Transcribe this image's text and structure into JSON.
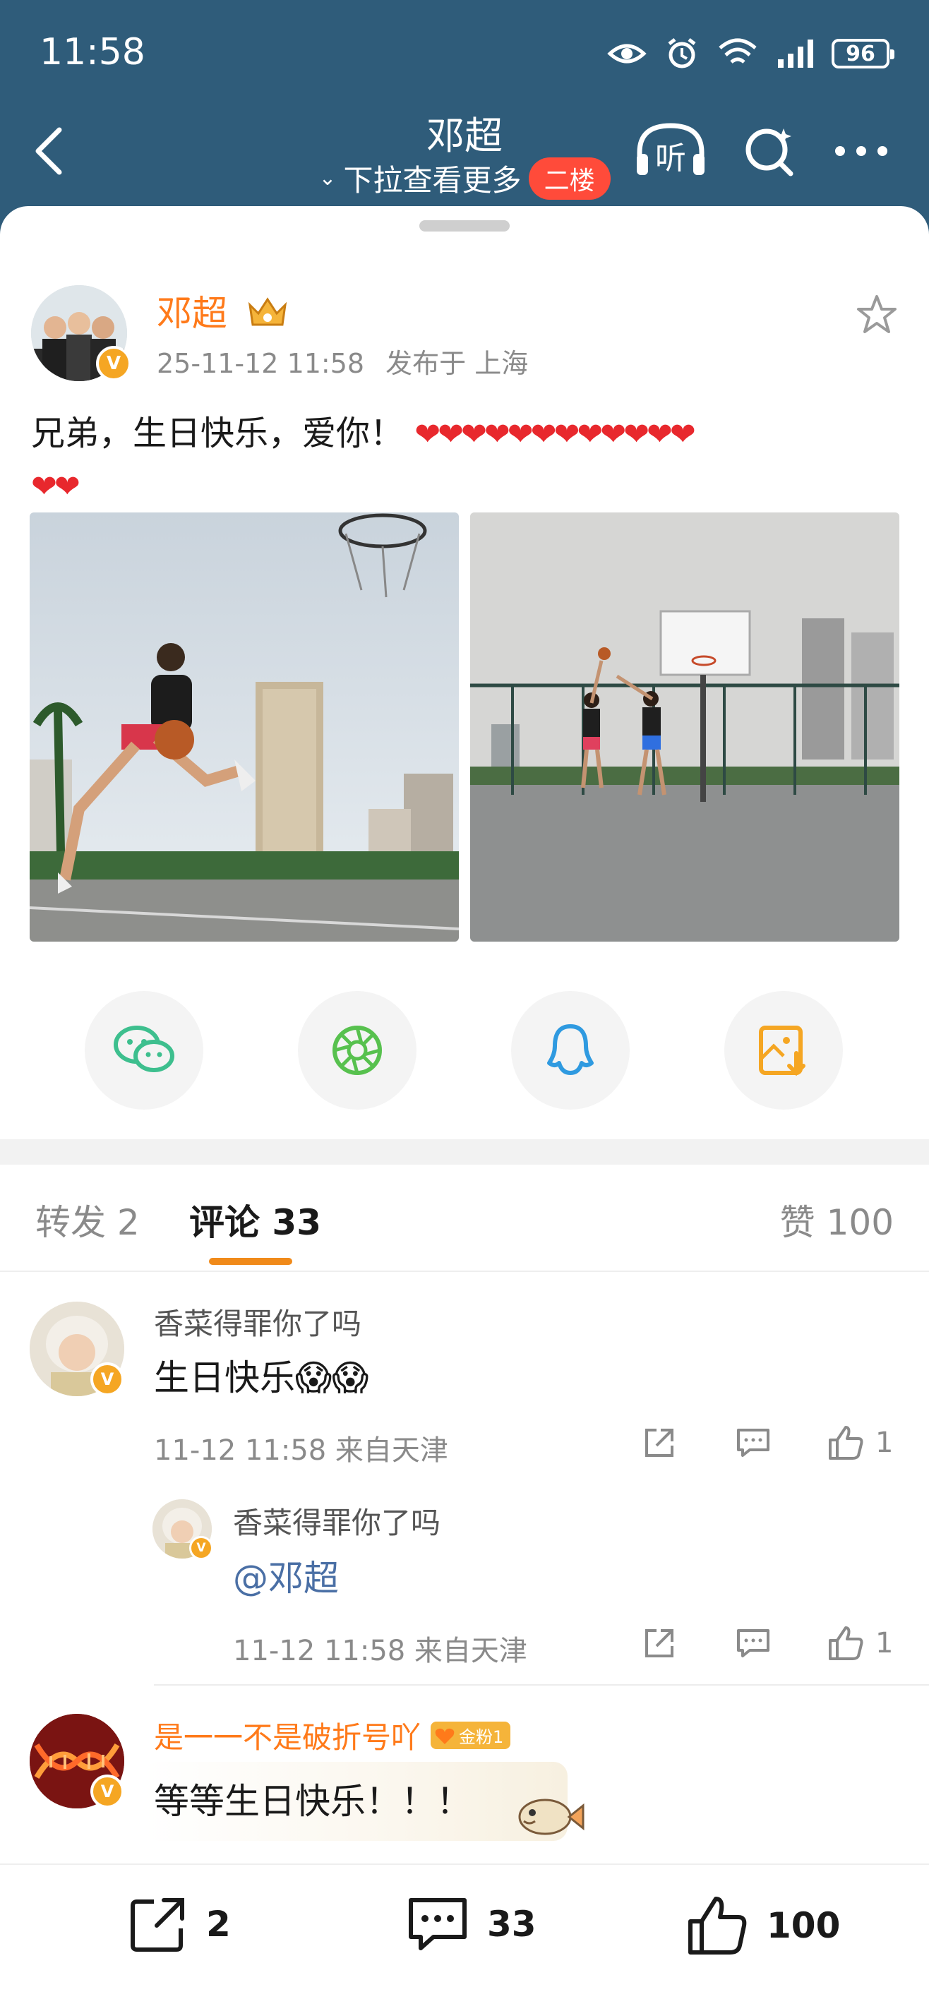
{
  "status_bar": {
    "time": "11:58",
    "battery": "96"
  },
  "header": {
    "title": "邓超",
    "subtitle": "下拉查看更多",
    "badge": "二楼",
    "listen_label": "听"
  },
  "post": {
    "author": "邓超",
    "time": "25-11-12 11:58",
    "location": "发布于 上海",
    "text": "兄弟，生日快乐，爱你！",
    "hearts_line1": "❤❤❤❤❤❤❤❤❤❤❤❤",
    "hearts_line2": "❤❤"
  },
  "tabs": {
    "repost": "转发 2",
    "comment": "评论 33",
    "like": "赞 100"
  },
  "comments": [
    {
      "name": "香菜得罪你了吗",
      "text": "生日快乐😱😱",
      "meta": "11-12 11:58 来自天津",
      "likes": "1",
      "reply": {
        "name": "香菜得罪你了吗",
        "text": "@邓超",
        "meta": "11-12 11:58 来自天津",
        "likes": "1"
      }
    },
    {
      "name": "是一一不是破折号吖",
      "fan_badge": "金粉1",
      "text": "等等生日快乐！！！"
    }
  ],
  "bottom_bar": {
    "repost_count": "2",
    "comment_count": "33",
    "like_count": "100"
  },
  "colors": {
    "header_bg": "#2f5c7a",
    "accent_orange": "#ff7a1a",
    "heart_red": "#e8282d",
    "badge_red": "#ff4b3a",
    "tab_underline": "#f08a1a"
  }
}
